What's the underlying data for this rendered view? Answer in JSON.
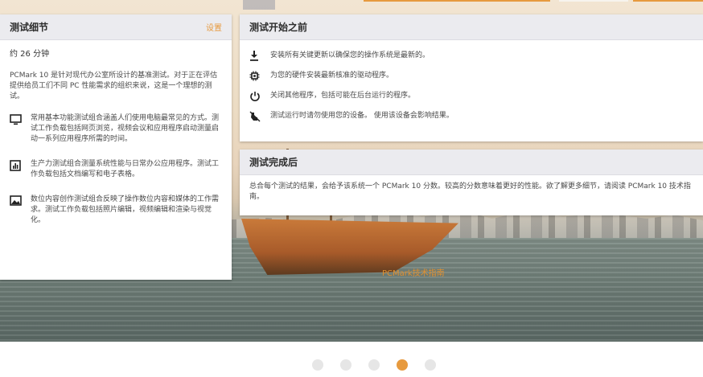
{
  "background": {
    "watermark_text": "PCMark技术指南"
  },
  "details_panel": {
    "title": "测试细节",
    "settings_label": "设置",
    "duration": "约 26 分钟",
    "description": "PCMark 10 是针对现代办公室所设计的基准测试。对于正在评估提供给员工们不同 PC 性能需求的组织来说，这是一个理想的测试。",
    "features": [
      {
        "icon": "monitor-icon",
        "text": "常用基本功能测试组合涵盖人们使用电脑最常见的方式。测试工作负载包括网页浏览，视频会议和应用程序启动测量启动一系列应用程序所需的时间。"
      },
      {
        "icon": "bar-chart-icon",
        "text": "生产力测试组合测量系统性能与日常办公应用程序。测试工作负载包括文档编写和电子表格。"
      },
      {
        "icon": "image-icon",
        "text": "数位内容创作测试组合反映了操作数位内容和媒体的工作需求。测试工作负载包括照片编辑，视频编辑和渲染与视觉化。"
      }
    ]
  },
  "before_panel": {
    "title": "测试开始之前",
    "items": [
      {
        "icon": "download-icon",
        "text": "安装所有关键更新以确保您的操作系统是最新的。"
      },
      {
        "icon": "chip-icon",
        "text": "为您的硬件安装最新核准的驱动程序。"
      },
      {
        "icon": "power-icon",
        "text": "关闭其他程序，包括可能在后台运行的程序。"
      },
      {
        "icon": "no-touch-icon",
        "text": "测试运行时请勿使用您的设备。 使用该设备会影响结果。"
      }
    ]
  },
  "after_panel": {
    "title": "测试完成后",
    "text": "总合每个测试的结果，会给予该系统一个 PCMark 10 分数。较高的分数意味着更好的性能。欲了解更多细节，请阅读 PCMark 10 技术指南。"
  },
  "pager": {
    "total": 5,
    "active_index": 3
  },
  "colors": {
    "accent": "#e79a3f",
    "panel_header": "#ebebef"
  }
}
